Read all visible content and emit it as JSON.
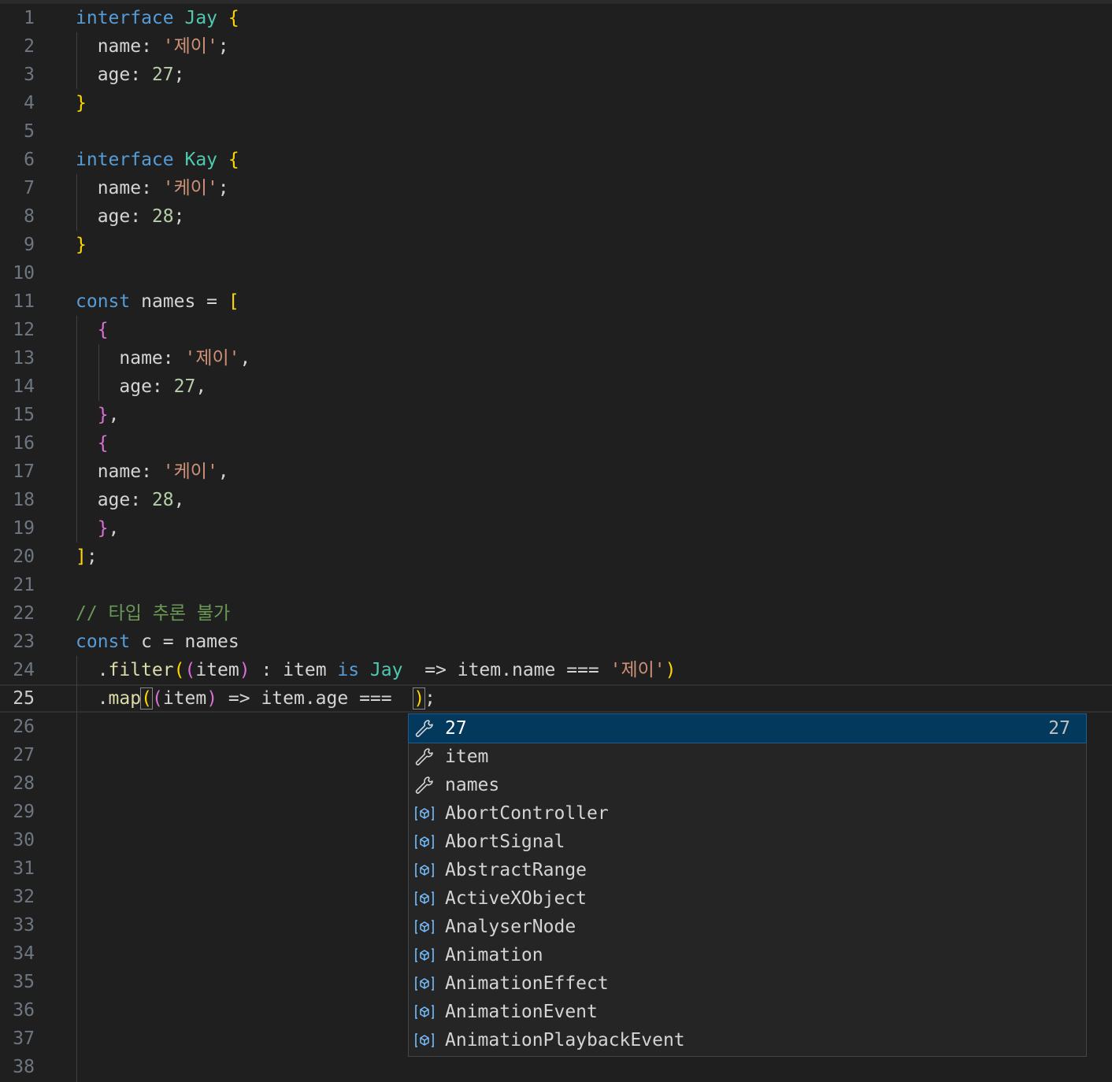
{
  "editor": {
    "line_numbers": [
      "1",
      "2",
      "3",
      "4",
      "5",
      "6",
      "7",
      "8",
      "9",
      "10",
      "11",
      "12",
      "13",
      "14",
      "15",
      "16",
      "17",
      "18",
      "19",
      "20",
      "21",
      "22",
      "23",
      "24",
      "25",
      "26",
      "27",
      "28",
      "29",
      "30",
      "31",
      "32",
      "33",
      "34",
      "35",
      "36",
      "37",
      "38"
    ],
    "current_line": "25",
    "lines": [
      [
        [
          "k",
          "interface"
        ],
        [
          "v",
          " "
        ],
        [
          "t",
          "Jay"
        ],
        [
          "v",
          " "
        ],
        [
          "b1",
          "{"
        ]
      ],
      [
        [
          "v",
          "  name: "
        ],
        [
          "s",
          "'제이'"
        ],
        [
          "v",
          ";"
        ]
      ],
      [
        [
          "v",
          "  age: "
        ],
        [
          "n",
          "27"
        ],
        [
          "v",
          ";"
        ]
      ],
      [
        [
          "b1",
          "}"
        ]
      ],
      [],
      [
        [
          "k",
          "interface"
        ],
        [
          "v",
          " "
        ],
        [
          "t",
          "Kay"
        ],
        [
          "v",
          " "
        ],
        [
          "b1",
          "{"
        ]
      ],
      [
        [
          "v",
          "  name: "
        ],
        [
          "s",
          "'케이'"
        ],
        [
          "v",
          ";"
        ]
      ],
      [
        [
          "v",
          "  age: "
        ],
        [
          "n",
          "28"
        ],
        [
          "v",
          ";"
        ]
      ],
      [
        [
          "b1",
          "}"
        ]
      ],
      [],
      [
        [
          "k",
          "const"
        ],
        [
          "v",
          " names = "
        ],
        [
          "b1",
          "["
        ]
      ],
      [
        [
          "v",
          "  "
        ],
        [
          "b2",
          "{"
        ]
      ],
      [
        [
          "v",
          "    name: "
        ],
        [
          "s",
          "'제이'"
        ],
        [
          "v",
          ","
        ]
      ],
      [
        [
          "v",
          "    age: "
        ],
        [
          "n",
          "27"
        ],
        [
          "v",
          ","
        ]
      ],
      [
        [
          "v",
          "  "
        ],
        [
          "b2",
          "}"
        ],
        [
          "v",
          ","
        ]
      ],
      [
        [
          "v",
          "  "
        ],
        [
          "b2",
          "{"
        ]
      ],
      [
        [
          "v",
          "  name: "
        ],
        [
          "s",
          "'케이'"
        ],
        [
          "v",
          ","
        ]
      ],
      [
        [
          "v",
          "  age: "
        ],
        [
          "n",
          "28"
        ],
        [
          "v",
          ","
        ]
      ],
      [
        [
          "v",
          "  "
        ],
        [
          "b2",
          "}"
        ],
        [
          "v",
          ","
        ]
      ],
      [
        [
          "b1",
          "]"
        ],
        [
          "v",
          ";"
        ]
      ],
      [],
      [
        [
          "c",
          "// 타입 추론 불가"
        ]
      ],
      [
        [
          "k",
          "const"
        ],
        [
          "v",
          " c = names"
        ]
      ],
      [
        [
          "v",
          "  ."
        ],
        [
          "f",
          "filter"
        ],
        [
          "b1",
          "("
        ],
        [
          "b2",
          "("
        ],
        [
          "v",
          "item"
        ],
        [
          "b2",
          ")"
        ],
        [
          "v",
          " : item "
        ],
        [
          "k",
          "is"
        ],
        [
          "v",
          " "
        ],
        [
          "t",
          "Jay"
        ],
        [
          "v",
          "  => item.name === "
        ],
        [
          "s",
          "'제이'"
        ],
        [
          "b1",
          ")"
        ]
      ],
      [
        [
          "v",
          "  ."
        ],
        [
          "f",
          "map"
        ],
        [
          "b1m",
          "("
        ],
        [
          "b2",
          "("
        ],
        [
          "v",
          "item"
        ],
        [
          "b2",
          ")"
        ],
        [
          "v",
          " => item.age ===  "
        ],
        [
          "b1m",
          ")"
        ],
        [
          "v",
          ";"
        ]
      ],
      [],
      [],
      [],
      [],
      [],
      [],
      [],
      [],
      [],
      [],
      [],
      [],
      []
    ]
  },
  "suggest": {
    "items": [
      {
        "label": "27",
        "icon": "wrench-icon",
        "detail": "27",
        "selected": true
      },
      {
        "label": "item",
        "icon": "wrench-icon",
        "detail": ""
      },
      {
        "label": "names",
        "icon": "wrench-icon",
        "detail": ""
      },
      {
        "label": "AbortController",
        "icon": "variable-icon",
        "detail": ""
      },
      {
        "label": "AbortSignal",
        "icon": "variable-icon",
        "detail": ""
      },
      {
        "label": "AbstractRange",
        "icon": "variable-icon",
        "detail": ""
      },
      {
        "label": "ActiveXObject",
        "icon": "variable-icon",
        "detail": ""
      },
      {
        "label": "AnalyserNode",
        "icon": "variable-icon",
        "detail": ""
      },
      {
        "label": "Animation",
        "icon": "variable-icon",
        "detail": ""
      },
      {
        "label": "AnimationEffect",
        "icon": "variable-icon",
        "detail": ""
      },
      {
        "label": "AnimationEvent",
        "icon": "variable-icon",
        "detail": ""
      },
      {
        "label": "AnimationPlaybackEvent",
        "icon": "variable-icon",
        "detail": ""
      }
    ]
  }
}
